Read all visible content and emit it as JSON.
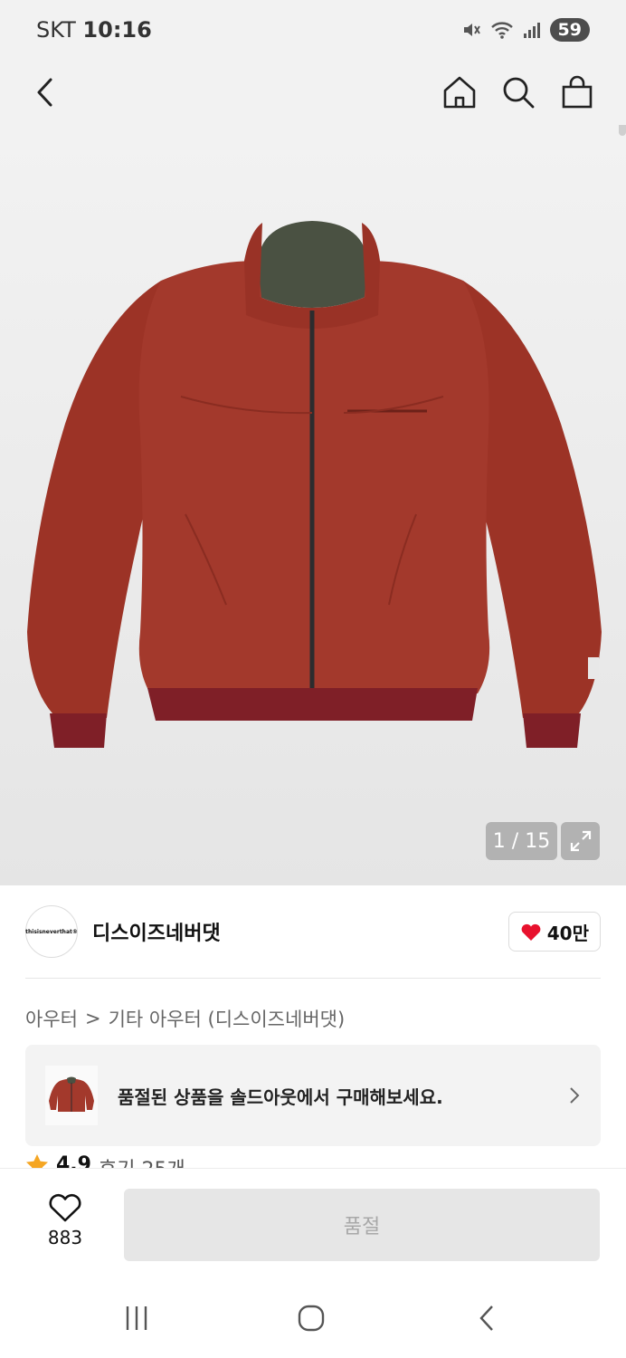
{
  "status_bar": {
    "carrier": "SKT",
    "time": "10:16",
    "battery": "59"
  },
  "top_nav": {
    "icons": [
      "back-arrow-icon",
      "home-icon",
      "search-icon",
      "shopping-bag-icon"
    ]
  },
  "gallery": {
    "image": "red-jacket",
    "counter": "1 / 15"
  },
  "brand": {
    "logo_text": "thisisneverthat®",
    "name": "디스이즈네버댓",
    "like_count": "40만"
  },
  "breadcrumb": {
    "category": "아우터",
    "separator": ">",
    "subcategory": "기타 아우터 (디스이즈네버댓)"
  },
  "soldout_banner": {
    "text": "품절된 상품을 솔드아웃에서 구매해보세요."
  },
  "rating": {
    "score": "4.9",
    "reviews": "후기 25개"
  },
  "bottom_bar": {
    "wish_count": "883",
    "action_label": "품절"
  },
  "colors": {
    "jacket": "#a3392c",
    "accent_heart": "#e8112d",
    "collar": "#4a5142"
  }
}
